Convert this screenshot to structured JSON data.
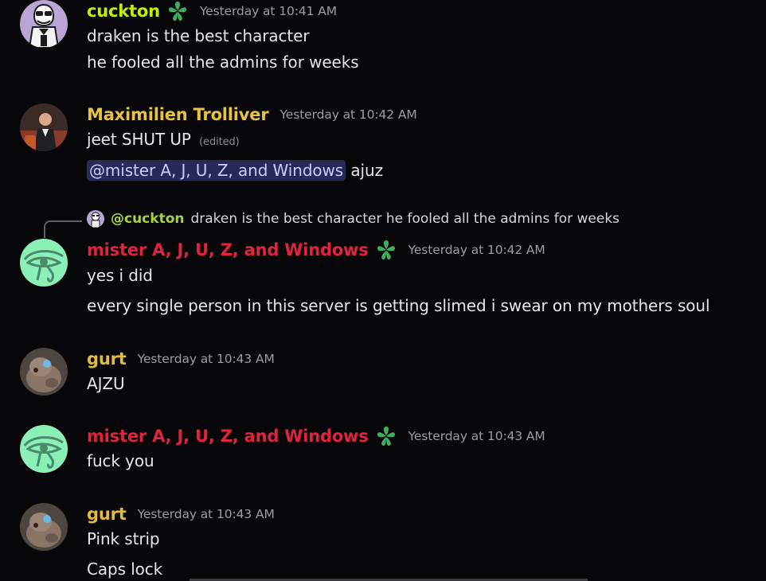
{
  "colors": {
    "background": "#070709",
    "cuckton_name": "#c3f000",
    "maximilien_name": "#e9c23f",
    "mister_name": "#e1233d",
    "gurt_name": "#e5bb3c",
    "timestamp": "#9a9ca4",
    "mention_bg": "#262a54",
    "mention_text": "#c8ccff",
    "flower_icon": "#3fae5e"
  },
  "messages": [
    {
      "username": "cuckton",
      "has_flower": true,
      "flower_icon": "leaf-flower-icon",
      "timestamp": "Yesterday at 10:41 AM",
      "lines": [
        "draken is the best character",
        "he fooled all the admins for weeks"
      ]
    },
    {
      "username": "Maximilien Trolliver",
      "timestamp": "Yesterday at 10:42 AM",
      "line1_text": "jeet SHUT UP",
      "line1_edited": "(edited)",
      "mention": "@mister A, J, U, Z, and Windows",
      "line2_after": " ajuz"
    },
    {
      "reply": {
        "user": "@cuckton",
        "text": "draken is the best character he fooled all the admins for weeks"
      },
      "username": "mister A, J, U, Z, and Windows",
      "has_flower": true,
      "timestamp": "Yesterday at 10:42 AM",
      "lines": [
        "yes i did",
        "every single person in this server is getting slimed i swear on my mothers soul"
      ]
    },
    {
      "username": "gurt",
      "timestamp": "Yesterday at 10:43 AM",
      "lines": [
        "AJZU"
      ]
    },
    {
      "username": "mister A, J, U, Z, and Windows",
      "has_flower": true,
      "timestamp": "Yesterday at 10:43 AM",
      "lines": [
        "fuck you"
      ]
    },
    {
      "username": "gurt",
      "timestamp": "Yesterday at 10:43 AM",
      "lines": [
        "Pink strip",
        "Caps lock"
      ]
    }
  ]
}
